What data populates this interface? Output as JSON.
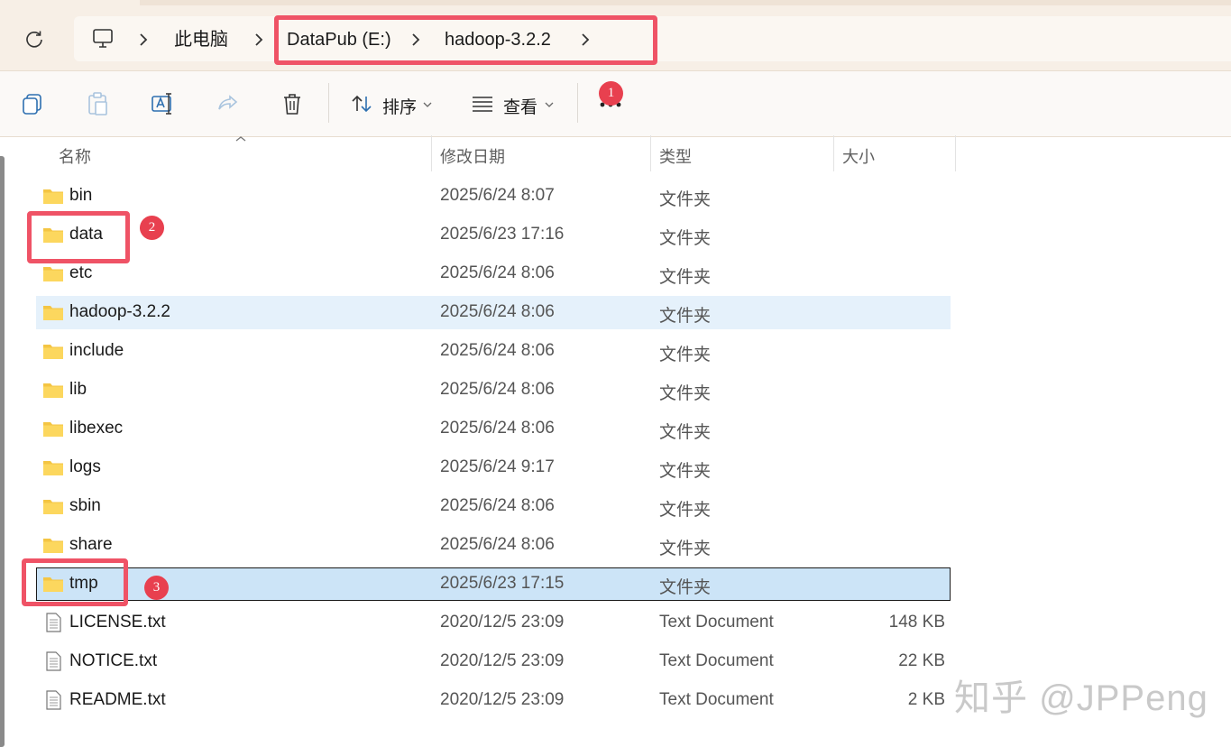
{
  "breadcrumb": {
    "items": [
      "此电脑",
      "DataPub (E:)",
      "hadoop-3.2.2"
    ]
  },
  "toolbar": {
    "sort_label": "排序",
    "view_label": "查看"
  },
  "annotations": {
    "b1": "1",
    "b2": "2",
    "b3": "3",
    "color": "#e8404f"
  },
  "columns": {
    "name": "名称",
    "modified": "修改日期",
    "type": "类型",
    "size": "大小"
  },
  "files": [
    {
      "name": "bin",
      "modified": "2025/6/24 8:07",
      "type": "文件夹",
      "size": "",
      "kind": "folder"
    },
    {
      "name": "data",
      "modified": "2025/6/23 17:16",
      "type": "文件夹",
      "size": "",
      "kind": "folder"
    },
    {
      "name": "etc",
      "modified": "2025/6/24 8:06",
      "type": "文件夹",
      "size": "",
      "kind": "folder"
    },
    {
      "name": "hadoop-3.2.2",
      "modified": "2025/6/24 8:06",
      "type": "文件夹",
      "size": "",
      "kind": "folder"
    },
    {
      "name": "include",
      "modified": "2025/6/24 8:06",
      "type": "文件夹",
      "size": "",
      "kind": "folder"
    },
    {
      "name": "lib",
      "modified": "2025/6/24 8:06",
      "type": "文件夹",
      "size": "",
      "kind": "folder"
    },
    {
      "name": "libexec",
      "modified": "2025/6/24 8:06",
      "type": "文件夹",
      "size": "",
      "kind": "folder"
    },
    {
      "name": "logs",
      "modified": "2025/6/24 9:17",
      "type": "文件夹",
      "size": "",
      "kind": "folder"
    },
    {
      "name": "sbin",
      "modified": "2025/6/24 8:06",
      "type": "文件夹",
      "size": "",
      "kind": "folder"
    },
    {
      "name": "share",
      "modified": "2025/6/24 8:06",
      "type": "文件夹",
      "size": "",
      "kind": "folder"
    },
    {
      "name": "tmp",
      "modified": "2025/6/23 17:15",
      "type": "文件夹",
      "size": "",
      "kind": "folder"
    },
    {
      "name": "LICENSE.txt",
      "modified": "2020/12/5 23:09",
      "type": "Text Document",
      "size": "148 KB",
      "kind": "text"
    },
    {
      "name": "NOTICE.txt",
      "modified": "2020/12/5 23:09",
      "type": "Text Document",
      "size": "22 KB",
      "kind": "text"
    },
    {
      "name": "README.txt",
      "modified": "2020/12/5 23:09",
      "type": "Text Document",
      "size": "2 KB",
      "kind": "text"
    }
  ],
  "watermark": "知乎 @JPPeng"
}
